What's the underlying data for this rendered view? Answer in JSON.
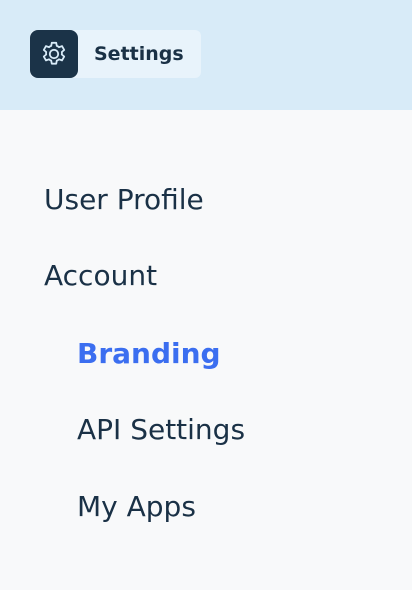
{
  "header": {
    "chip_label": "Settings",
    "icon": "gear-icon"
  },
  "menu": {
    "items": [
      {
        "label": "User Profile",
        "active": false
      },
      {
        "label": "Account",
        "active": false
      },
      {
        "label": "Branding",
        "active": true
      },
      {
        "label": "API Settings",
        "active": false
      },
      {
        "label": "My Apps",
        "active": false
      }
    ]
  },
  "colors": {
    "header_background": "#d8ebf8",
    "chip_background": "#e8f3fb",
    "icon_background": "#1b3348",
    "text": "#1a3146",
    "active": "#3b6ef0",
    "page_background": "#f8f9fa"
  }
}
